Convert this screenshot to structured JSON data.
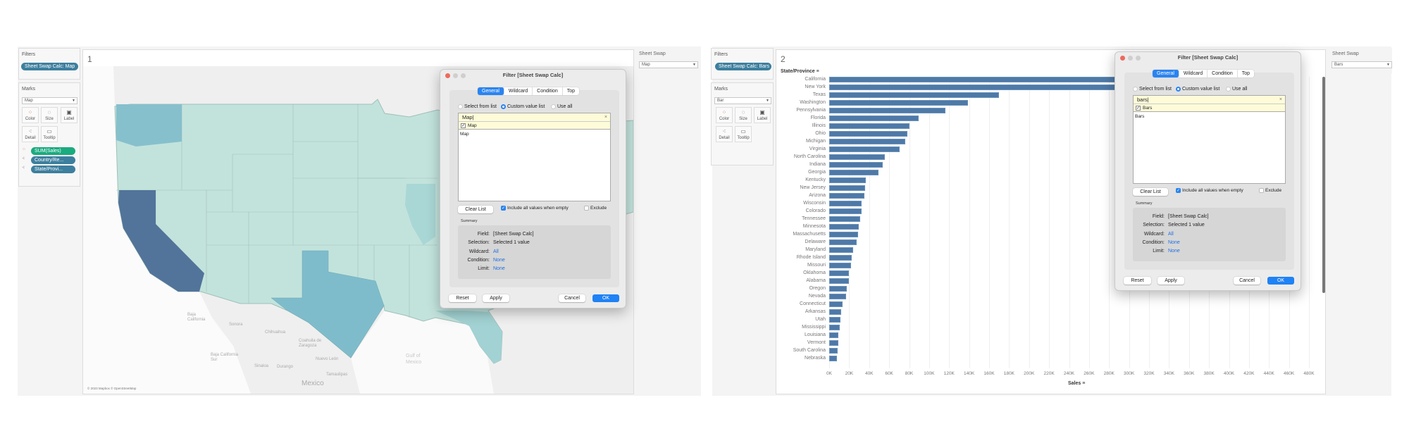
{
  "left": {
    "filters_title": "Filters",
    "filter_pill": "Sheet Swap Calc: Map",
    "marks_title": "Marks",
    "mark_type": "Map",
    "mark_buttons": [
      "Color",
      "Size",
      "Label",
      "Detail",
      "Tooltip"
    ],
    "mark_pills": [
      "SUM(Sales)",
      "Country/Re...",
      "State/Provi..."
    ],
    "sheet_number": "1",
    "sheet_swap_title": "Sheet Swap",
    "sheet_swap_value": "Map",
    "map_attribution": "© 2023 Mapbox © OpenStreetMap",
    "map_labels": [
      "Baja California",
      "Sonora",
      "Chihuahua",
      "Coahuila de Zaragoza",
      "Baja California Sur",
      "Sinaloa",
      "Durango",
      "Nuevo León",
      "Tamaulipas",
      "Mexico",
      "Gulf of Mexico"
    ],
    "state_colors": {
      "California": "#52749a",
      "Texas": "#7fbccb",
      "Washington": "#86c0cc",
      "Florida": "#a2d2d3",
      "Illinois": "#a9d7d5",
      "other": "#c2e3dc"
    }
  },
  "right": {
    "filters_title": "Filters",
    "filter_pill": "Sheet Swap Calc: Bars",
    "marks_title": "Marks",
    "mark_type": "Bar",
    "mark_buttons": [
      "Color",
      "Size",
      "Label",
      "Detail",
      "Tooltip"
    ],
    "sheet_number": "2",
    "sheet_swap_title": "Sheet Swap",
    "sheet_swap_value": "Bars"
  },
  "dialogs": [
    {
      "title": "Filter [Sheet Swap Calc]",
      "tabs": [
        "General",
        "Wildcard",
        "Condition",
        "Top"
      ],
      "radios": [
        "Select from list",
        "Custom value list",
        "Use all"
      ],
      "search_value": "Map",
      "checked_item": "Map",
      "list_items": [
        "Map"
      ],
      "clear_list": "Clear List",
      "include_all": "Include all values when empty",
      "exclude": "Exclude",
      "summary_label": "Summary",
      "summary": [
        {
          "k": "Field:",
          "v": "[Sheet Swap Calc]"
        },
        {
          "k": "Selection:",
          "v": "Selected 1 value"
        },
        {
          "k": "Wildcard:",
          "v": "All"
        },
        {
          "k": "Condition:",
          "v": "None"
        },
        {
          "k": "Limit:",
          "v": "None"
        }
      ],
      "buttons": [
        "Reset",
        "Apply",
        "Cancel",
        "OK"
      ]
    },
    {
      "title": "Filter [Sheet Swap Calc]",
      "tabs": [
        "General",
        "Wildcard",
        "Condition",
        "Top"
      ],
      "radios": [
        "Select from list",
        "Custom value list",
        "Use all"
      ],
      "search_value": "bars",
      "checked_item": "Bars",
      "list_items": [
        "Bars"
      ],
      "clear_list": "Clear List",
      "include_all": "Include all values when empty",
      "exclude": "Exclude",
      "summary_label": "Summary",
      "summary": [
        {
          "k": "Field:",
          "v": "[Sheet Swap Calc]"
        },
        {
          "k": "Selection:",
          "v": "Selected 1 value"
        },
        {
          "k": "Wildcard:",
          "v": "All"
        },
        {
          "k": "Condition:",
          "v": "None"
        },
        {
          "k": "Limit:",
          "v": "None"
        }
      ],
      "buttons": [
        "Reset",
        "Apply",
        "Cancel",
        "OK"
      ]
    }
  ],
  "chart_data": {
    "type": "bar",
    "orientation": "horizontal",
    "ylabel": "State/Province",
    "xlabel": "Sales",
    "xlim": [
      0,
      480
    ],
    "x_unit": "K",
    "x_ticks": [
      "0K",
      "20K",
      "40K",
      "60K",
      "80K",
      "100K",
      "120K",
      "140K",
      "160K",
      "180K",
      "200K",
      "220K",
      "240K",
      "260K",
      "280K",
      "300K",
      "320K",
      "340K",
      "360K",
      "380K",
      "400K",
      "420K",
      "440K",
      "460K",
      "480K"
    ],
    "categories": [
      "California",
      "New York",
      "Texas",
      "Washington",
      "Pennsylvania",
      "Florida",
      "Illinois",
      "Ohio",
      "Michigan",
      "Virginia",
      "North Carolina",
      "Indiana",
      "Georgia",
      "Kentucky",
      "New Jersey",
      "Arizona",
      "Wisconsin",
      "Colorado",
      "Tennessee",
      "Minnesota",
      "Massachusetts",
      "Delaware",
      "Maryland",
      "Rhode Island",
      "Missouri",
      "Oklahoma",
      "Alabama",
      "Oregon",
      "Nevada",
      "Connecticut",
      "Arkansas",
      "Utah",
      "Mississippi",
      "Louisiana",
      "Vermont",
      "South Carolina",
      "Nebraska"
    ],
    "values": [
      457.7,
      310.9,
      170.2,
      138.6,
      116.5,
      89.5,
      80.2,
      78.3,
      76.3,
      70.6,
      55.6,
      53.6,
      49.1,
      36.6,
      35.8,
      35.3,
      32.1,
      32.1,
      30.7,
      29.9,
      28.6,
      27.5,
      23.7,
      22.6,
      22.2,
      19.7,
      19.5,
      17.4,
      16.7,
      13.4,
      11.7,
      11.2,
      10.8,
      9.2,
      8.9,
      8.5,
      7.5
    ],
    "bar_color": "#4e79a7",
    "grid": true
  }
}
